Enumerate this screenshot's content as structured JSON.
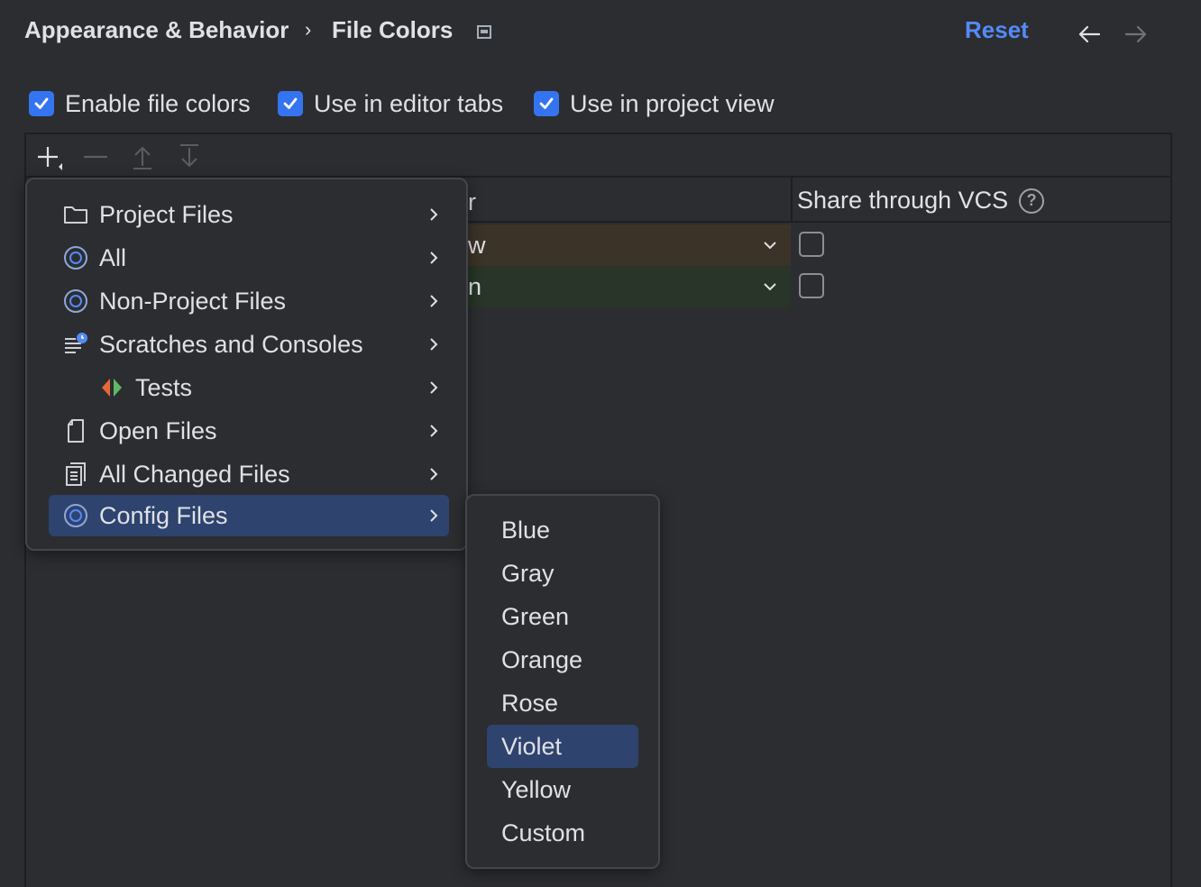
{
  "header": {
    "breadcrumb_parent": "Appearance & Behavior",
    "breadcrumb_separator": "›",
    "breadcrumb_current": "File Colors",
    "reset_label": "Reset",
    "icons": [
      "window-icon",
      "arrow-left-icon",
      "arrow-right-icon"
    ]
  },
  "options": [
    {
      "label": "Enable file colors",
      "checked": true
    },
    {
      "label": "Use in editor tabs",
      "checked": true
    },
    {
      "label": "Use in project view",
      "checked": true
    }
  ],
  "toolbar": {
    "icons": [
      "add-icon",
      "remove-icon",
      "move-up-icon",
      "move-down-icon"
    ]
  },
  "table": {
    "header_fragment": "r",
    "share_column": "Share through VCS",
    "help_glyph": "?",
    "rows": [
      {
        "color_fragment": "w",
        "shared": false,
        "bg": "#3c3328"
      },
      {
        "color_fragment": "n",
        "shared": false,
        "bg": "#283528"
      }
    ]
  },
  "menu": {
    "items": [
      {
        "label": "Project Files",
        "icon": "folder-icon"
      },
      {
        "label": "All",
        "icon": "scope-icon"
      },
      {
        "label": "Non-Project Files",
        "icon": "scope-icon"
      },
      {
        "label": "Scratches and Consoles",
        "icon": "scratches-icon"
      },
      {
        "label": "Tests",
        "icon": "tests-icon"
      },
      {
        "label": "Open Files",
        "icon": "file-icon"
      },
      {
        "label": "All Changed Files",
        "icon": "changed-files-icon"
      },
      {
        "label": "Config Files",
        "icon": "scope-icon",
        "selected": true
      }
    ]
  },
  "submenu": {
    "items": [
      {
        "label": "Blue"
      },
      {
        "label": "Gray"
      },
      {
        "label": "Green"
      },
      {
        "label": "Orange"
      },
      {
        "label": "Rose"
      },
      {
        "label": "Violet",
        "selected": true
      },
      {
        "label": "Yellow"
      },
      {
        "label": "Custom"
      }
    ]
  },
  "colors": {
    "background": "#2b2d30",
    "accent": "#548af7",
    "checkbox": "#3574f0",
    "selection": "#2e436e"
  }
}
